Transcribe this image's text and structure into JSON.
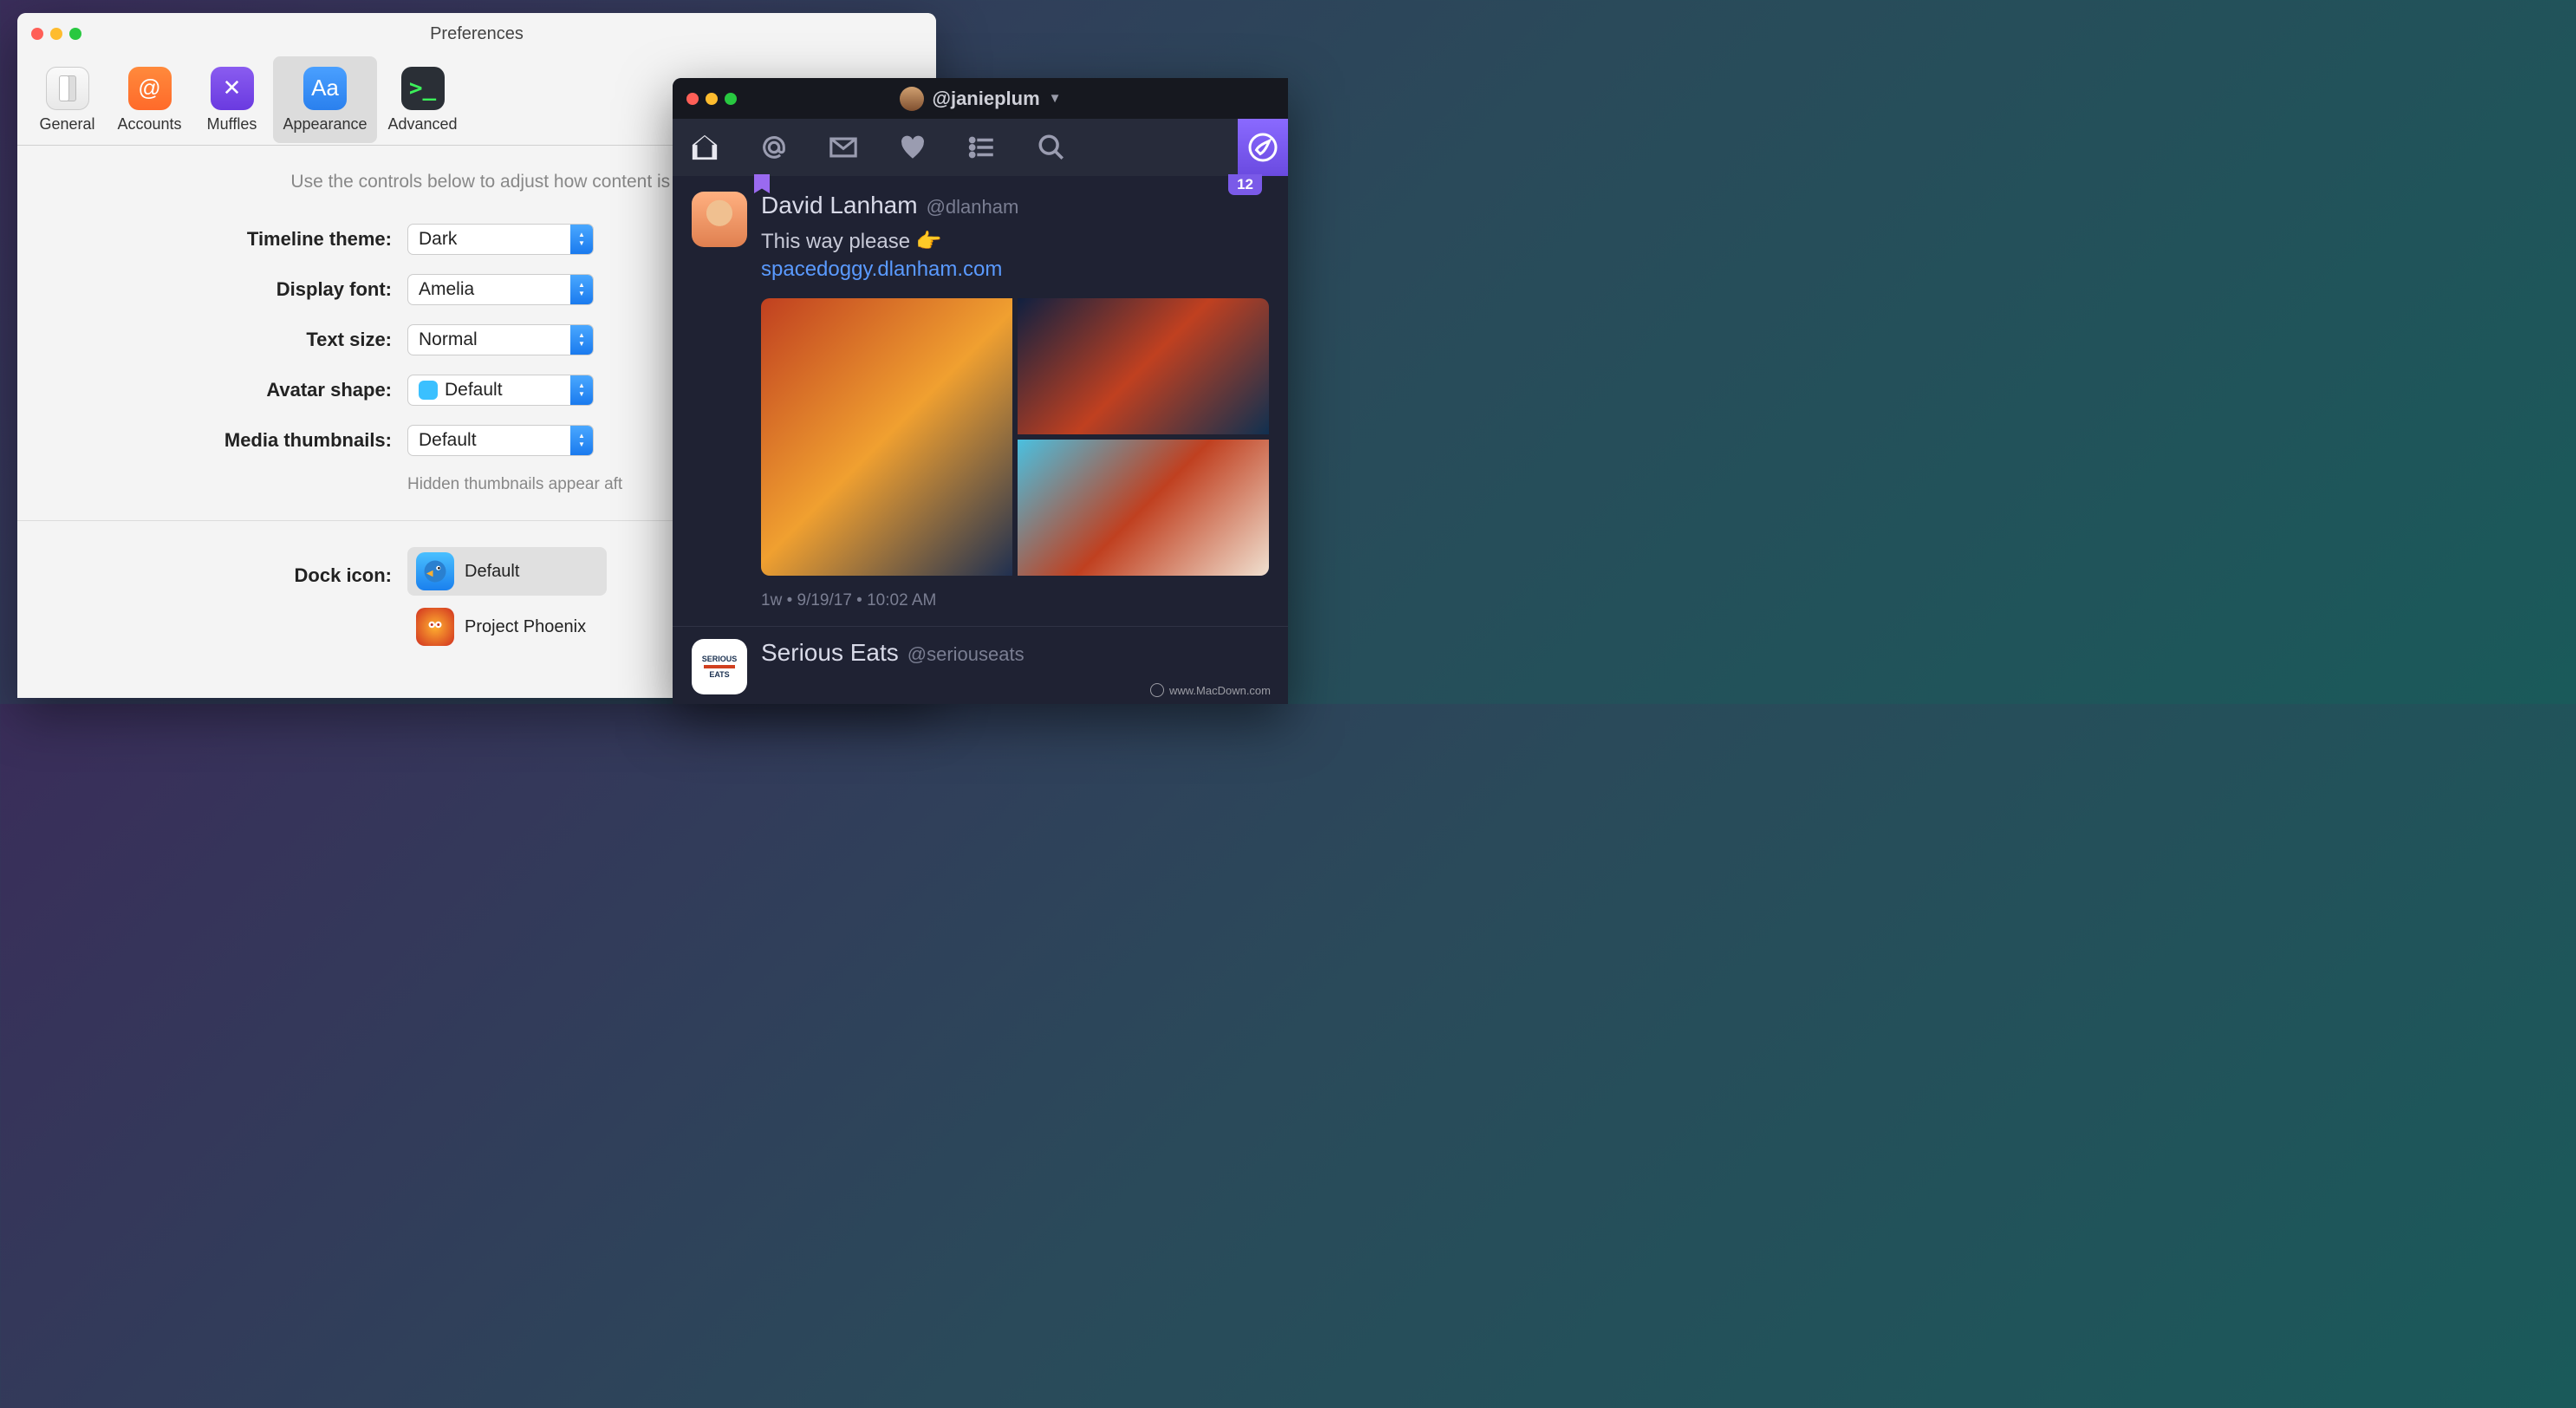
{
  "preferences": {
    "window_title": "Preferences",
    "toolbar": [
      {
        "id": "general",
        "label": "General"
      },
      {
        "id": "accounts",
        "label": "Accounts"
      },
      {
        "id": "muffles",
        "label": "Muffles"
      },
      {
        "id": "appearance",
        "label": "Appearance"
      },
      {
        "id": "advanced",
        "label": "Advanced"
      }
    ],
    "active_tab": "appearance",
    "caption": "Use the controls below to adjust how content is presented in",
    "fields": {
      "timeline_theme": {
        "label": "Timeline theme:",
        "value": "Dark"
      },
      "display_font": {
        "label": "Display font:",
        "value": "Amelia"
      },
      "text_size": {
        "label": "Text size:",
        "value": "Normal"
      },
      "avatar_shape": {
        "label": "Avatar shape:",
        "value": "Default"
      },
      "media_thumbnails": {
        "label": "Media thumbnails:",
        "value": "Default"
      }
    },
    "thumbnails_hint": "Hidden thumbnails appear aft",
    "dock_icon": {
      "label": "Dock icon:",
      "options": [
        {
          "id": "default",
          "label": "Default"
        },
        {
          "id": "phoenix",
          "label": "Project Phoenix"
        }
      ],
      "selected": "default"
    }
  },
  "timeline": {
    "account_handle": "@janieplum",
    "tabs": [
      "home",
      "mentions",
      "messages",
      "likes",
      "lists",
      "search"
    ],
    "active_tab": "home",
    "badge_count": "12",
    "posts": [
      {
        "author_name": "David Lanham",
        "author_handle": "@dlanham",
        "text": "This way please 👉",
        "link": "spacedoggy.dlanham.com",
        "timestamp": "1w • 9/19/17 • 10:02 AM",
        "bookmarked": true
      },
      {
        "author_name": "Serious Eats",
        "author_handle": "@seriouseats"
      }
    ]
  },
  "watermark": "www.MacDown.com"
}
